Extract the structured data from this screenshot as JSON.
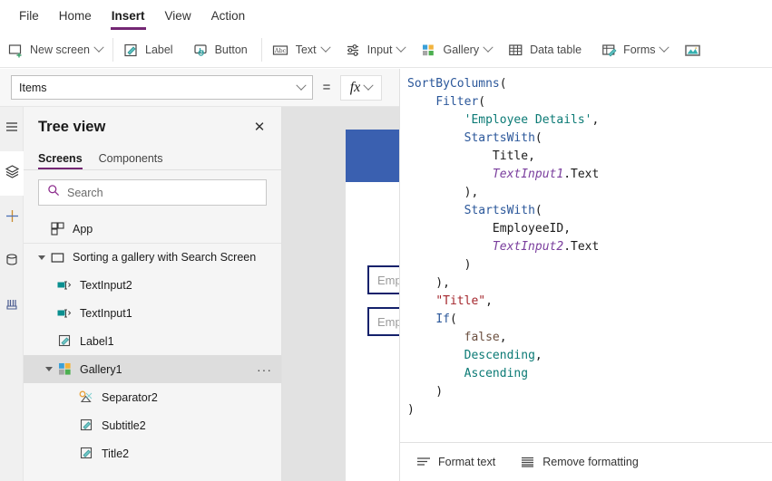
{
  "menu": {
    "items": [
      {
        "label": "File",
        "active": false
      },
      {
        "label": "Home",
        "active": false
      },
      {
        "label": "Insert",
        "active": true
      },
      {
        "label": "View",
        "active": false
      },
      {
        "label": "Action",
        "active": false
      }
    ]
  },
  "ribbon": {
    "items": [
      {
        "label": "New screen",
        "icon": "new-screen-icon",
        "caret": true
      },
      {
        "label": "Label",
        "icon": "label-icon",
        "caret": false
      },
      {
        "label": "Button",
        "icon": "button-icon",
        "caret": false
      },
      {
        "label": "Text",
        "icon": "text-icon",
        "caret": true
      },
      {
        "label": "Input",
        "icon": "input-icon",
        "caret": true
      },
      {
        "label": "Gallery",
        "icon": "gallery-icon",
        "caret": true
      },
      {
        "label": "Data table",
        "icon": "data-table-icon",
        "caret": false
      },
      {
        "label": "Forms",
        "icon": "forms-icon",
        "caret": true
      },
      {
        "label": "",
        "icon": "media-icon",
        "caret": false
      }
    ]
  },
  "property_bar": {
    "selected_property": "Items",
    "equals": "=",
    "fx_label": "fx"
  },
  "rail": {
    "items": [
      {
        "icon": "hamburger-icon",
        "active": false
      },
      {
        "icon": "layers-icon",
        "active": true
      },
      {
        "icon": "plus-icon",
        "active": false
      },
      {
        "icon": "data-icon",
        "active": false
      },
      {
        "icon": "media-library-icon",
        "active": false
      }
    ]
  },
  "tree_view": {
    "title": "Tree view",
    "close_label": "✕",
    "tabs": [
      {
        "label": "Screens",
        "active": true
      },
      {
        "label": "Components",
        "active": false
      }
    ],
    "search_placeholder": "Search",
    "items": [
      {
        "label": "App",
        "icon": "app-icon",
        "level": 1,
        "twist": "none",
        "selected": false,
        "overflow": false,
        "divider_below": true
      },
      {
        "label": "Sorting a gallery with Search Screen",
        "icon": "screen-icon",
        "level": 1,
        "twist": "expanded",
        "selected": false,
        "overflow": false,
        "divider_below": false
      },
      {
        "label": "TextInput2",
        "icon": "textinput-icon",
        "level": 2,
        "twist": "none",
        "selected": false,
        "overflow": false,
        "divider_below": false
      },
      {
        "label": "TextInput1",
        "icon": "textinput-icon",
        "level": 2,
        "twist": "none",
        "selected": false,
        "overflow": false,
        "divider_below": false
      },
      {
        "label": "Label1",
        "icon": "label-icon",
        "level": 2,
        "twist": "none",
        "selected": false,
        "overflow": false,
        "divider_below": false
      },
      {
        "label": "Gallery1",
        "icon": "gallery-icon",
        "level": 2,
        "twist": "expanded",
        "selected": true,
        "overflow": true,
        "divider_below": false
      },
      {
        "label": "Separator2",
        "icon": "separator-icon",
        "level": 3,
        "twist": "none",
        "selected": false,
        "overflow": false,
        "divider_below": false
      },
      {
        "label": "Subtitle2",
        "icon": "label-icon",
        "level": 3,
        "twist": "none",
        "selected": false,
        "overflow": false,
        "divider_below": false
      },
      {
        "label": "Title2",
        "icon": "label-icon",
        "level": 3,
        "twist": "none",
        "selected": false,
        "overflow": false,
        "divider_below": false
      }
    ],
    "overflow_label": "···"
  },
  "canvas": {
    "header_color": "#3a60b0",
    "text_inputs": [
      {
        "placeholder": "Employee Name"
      },
      {
        "placeholder": "Employee ID"
      }
    ]
  },
  "formula": {
    "tokens": [
      {
        "t": "SortByColumns",
        "c": "t-fn"
      },
      {
        "t": "(\n    ",
        "c": "t-punc"
      },
      {
        "t": "Filter",
        "c": "t-fn"
      },
      {
        "t": "(\n        ",
        "c": "t-punc"
      },
      {
        "t": "'Employee Details'",
        "c": "t-str"
      },
      {
        "t": ",\n        ",
        "c": "t-punc"
      },
      {
        "t": "StartsWith",
        "c": "t-fn"
      },
      {
        "t": "(\n            ",
        "c": "t-punc"
      },
      {
        "t": "Title",
        "c": "t-ident"
      },
      {
        "t": ",\n            ",
        "c": "t-punc"
      },
      {
        "t": "TextInput1",
        "c": "t-ctl"
      },
      {
        "t": ".Text",
        "c": "t-ident"
      },
      {
        "t": "\n        ),\n        ",
        "c": "t-punc"
      },
      {
        "t": "StartsWith",
        "c": "t-fn"
      },
      {
        "t": "(\n            ",
        "c": "t-punc"
      },
      {
        "t": "EmployeeID",
        "c": "t-ident"
      },
      {
        "t": ",\n            ",
        "c": "t-punc"
      },
      {
        "t": "TextInput2",
        "c": "t-ctl"
      },
      {
        "t": ".Text",
        "c": "t-ident"
      },
      {
        "t": "\n        )\n    ),\n    ",
        "c": "t-punc"
      },
      {
        "t": "\"Title\"",
        "c": "t-dqstr"
      },
      {
        "t": ",\n    ",
        "c": "t-punc"
      },
      {
        "t": "If",
        "c": "t-ctrl"
      },
      {
        "t": "(\n        ",
        "c": "t-punc"
      },
      {
        "t": "false",
        "c": "t-bool"
      },
      {
        "t": ",\n        ",
        "c": "t-punc"
      },
      {
        "t": "Descending",
        "c": "t-enum"
      },
      {
        "t": ",\n        ",
        "c": "t-punc"
      },
      {
        "t": "Ascending",
        "c": "t-enum"
      },
      {
        "t": "\n    )\n)",
        "c": "t-punc"
      }
    ],
    "footer": {
      "format_text": "Format text",
      "remove_formatting": "Remove formatting"
    }
  }
}
